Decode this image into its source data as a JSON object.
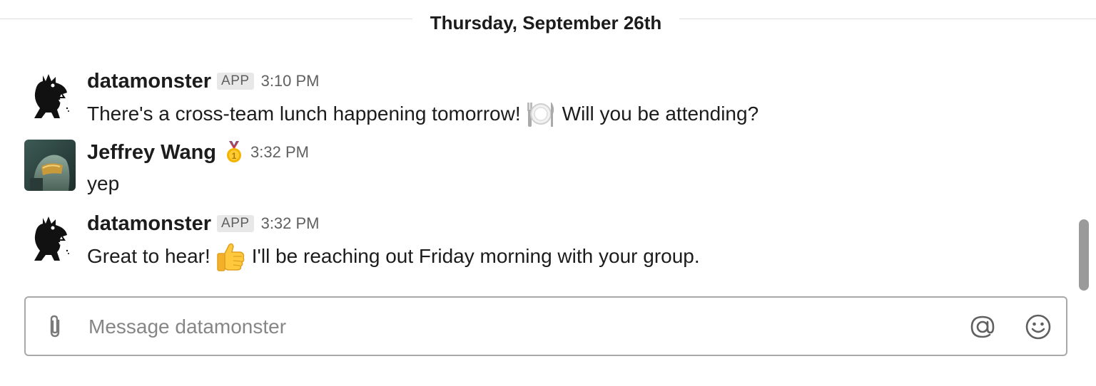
{
  "date_divider": {
    "label": "Thursday, September 26th"
  },
  "messages": [
    {
      "sender": "datamonster",
      "badge": "APP",
      "time": "3:10 PM",
      "avatar_icon": "datamonster-logo",
      "text_before": "There's a cross-team lunch happening tomorrow!",
      "emoji": "plate-with-cutlery-emoji",
      "text_after": "Will you be attending?"
    },
    {
      "sender": "Jeffrey Wang",
      "status_emoji": "first-place-medal-emoji",
      "time": "3:32 PM",
      "avatar_icon": "user-photo-avatar",
      "text": "yep"
    },
    {
      "sender": "datamonster",
      "badge": "APP",
      "time": "3:32 PM",
      "avatar_icon": "datamonster-logo",
      "text_before": "Great to hear!",
      "emoji": "thumbs-up-emoji",
      "text_after": "I'll be reaching out Friday morning with your group."
    }
  ],
  "composer": {
    "placeholder": "Message datamonster",
    "value": "",
    "attach_icon": "paperclip-icon",
    "mention_icon": "at-sign-icon",
    "emoji_icon": "smiley-icon"
  },
  "colors": {
    "text": "#1d1c1d",
    "muted": "#616061",
    "border": "#a9a9a9",
    "divider": "#dddddd",
    "badge_bg": "#e8e8e8"
  }
}
